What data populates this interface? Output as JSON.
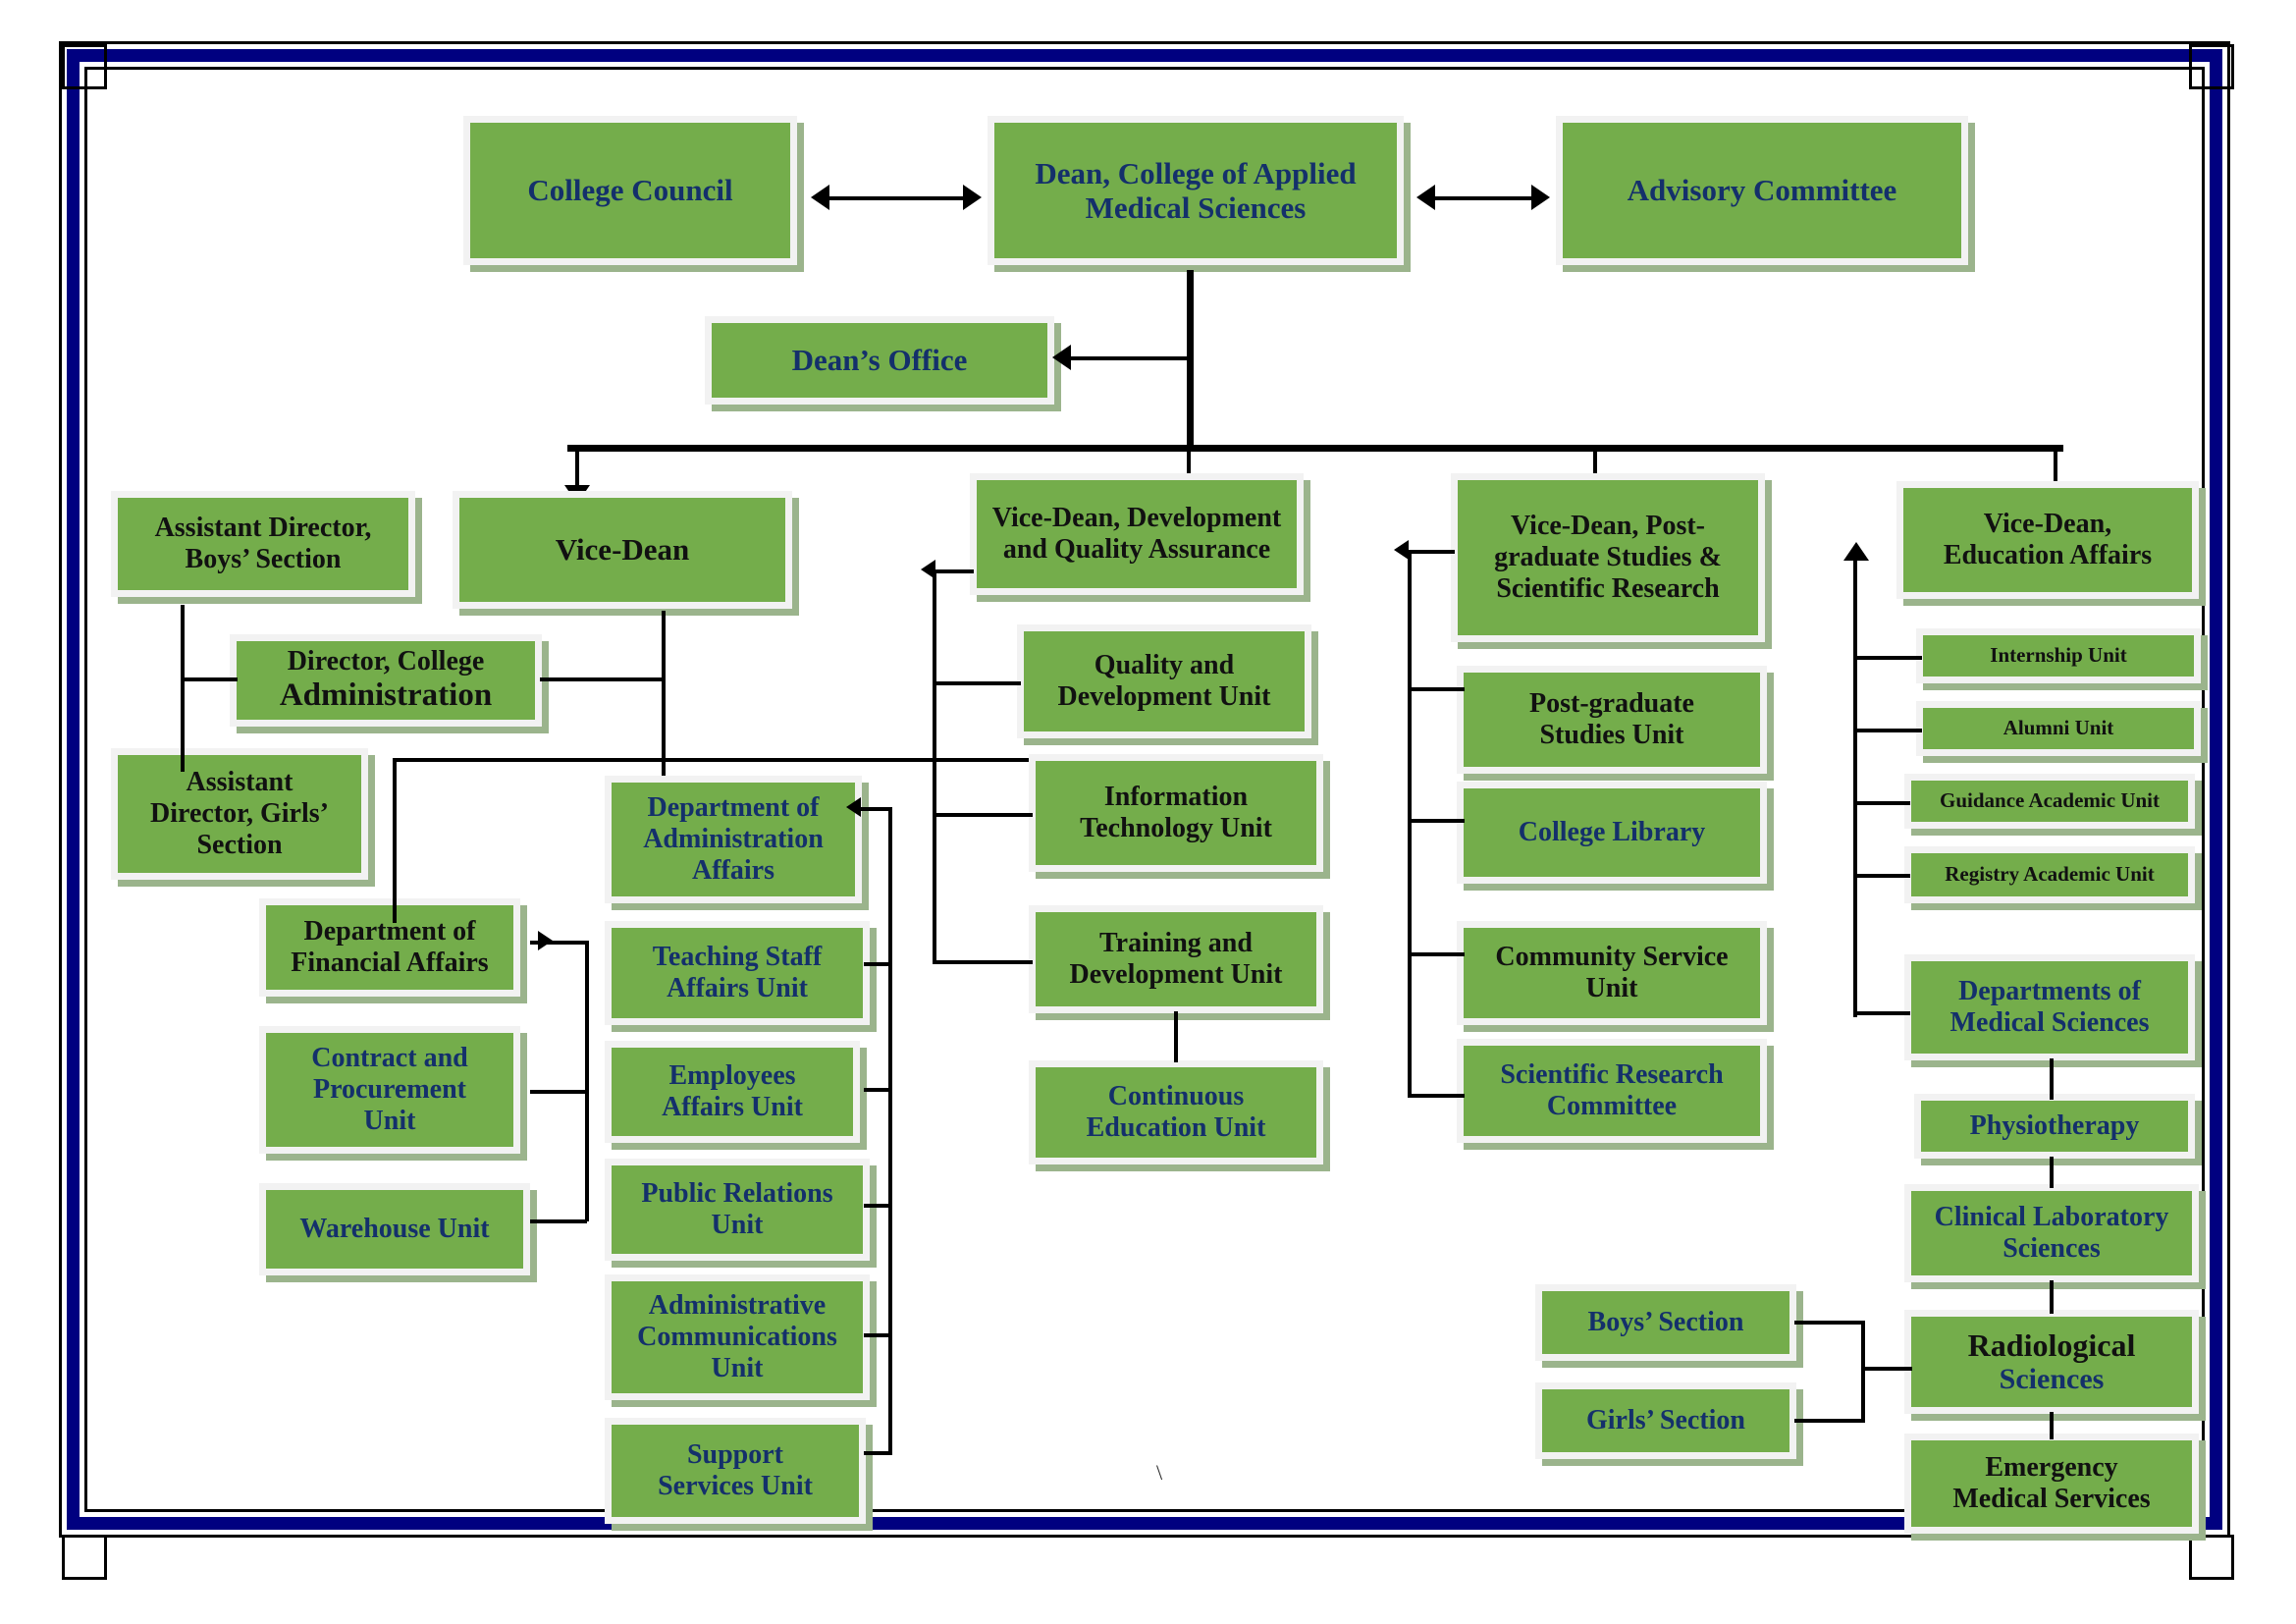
{
  "document": {
    "title": "College of Applied Medical Sciences — Organizational Chart",
    "frame_color": "#000080",
    "node_fill": "#74ad4b",
    "node_border": "#f2f2f2",
    "node_shadow": "#9bb48c",
    "text_blue": "#14306b",
    "text_black": "#111111"
  },
  "chart_data": {
    "type": "diagram",
    "subtype": "organizational-chart",
    "title": "College of Applied Medical Sciences Organizational Structure",
    "nodes": {
      "college_council": {
        "label": "College Council",
        "color": "blue"
      },
      "dean": {
        "label": "Dean, College of Applied\nMedical Sciences",
        "color": "blue"
      },
      "advisory_committee": {
        "label": "Advisory Committee",
        "color": "blue"
      },
      "deans_office": {
        "label": "Dean’s Office",
        "color": "blue"
      },
      "assistant_director_boys": {
        "label": "Assistant Director,\nBoys’ Section",
        "color": "black"
      },
      "vice_dean": {
        "label": "Vice-Dean",
        "color": "black"
      },
      "director_college_admin_line1": "Director, College",
      "director_college_admin_line2": "Administration",
      "assistant_director_girls": {
        "label": "Assistant\nDirector, Girls’\nSection",
        "color": "black"
      },
      "dept_financial_affairs": {
        "label": "Department of\nFinancial Affairs",
        "color": "black"
      },
      "contract_procurement": {
        "label": "Contract and\nProcurement\nUnit",
        "color": "blue"
      },
      "warehouse_unit": {
        "label": "Warehouse Unit",
        "color": "blue"
      },
      "dept_administration_affairs": {
        "label": "Department of\nAdministration\nAffairs",
        "color": "blue"
      },
      "teaching_staff_affairs": {
        "label": "Teaching Staff\nAffairs Unit",
        "color": "blue"
      },
      "employees_affairs": {
        "label": "Employees\nAffairs Unit",
        "color": "blue"
      },
      "public_relations": {
        "label": "Public Relations\nUnit",
        "color": "blue"
      },
      "administrative_communications": {
        "label": "Administrative\nCommunications\nUnit",
        "color": "blue"
      },
      "support_services": {
        "label": "Support\nServices Unit",
        "color": "blue"
      },
      "vice_dean_dev_qa": {
        "label": "Vice-Dean, Development\nand Quality Assurance",
        "color": "black"
      },
      "quality_development": {
        "label": "Quality and\nDevelopment Unit",
        "color": "black"
      },
      "information_technology": {
        "label": "Information\nTechnology Unit",
        "color": "black"
      },
      "training_development": {
        "label": "Training and\nDevelopment Unit",
        "color": "black"
      },
      "continuous_education": {
        "label": "Continuous\nEducation Unit",
        "color": "blue"
      },
      "vice_dean_postgrad": {
        "label": "Vice-Dean, Post-\ngraduate Studies &\nScientific Research",
        "color": "black"
      },
      "postgraduate_studies": {
        "label": "Post-graduate\nStudies Unit",
        "color": "black"
      },
      "college_library": {
        "label": "College Library",
        "color": "blue"
      },
      "community_service": {
        "label": "Community Service\nUnit",
        "color": "black"
      },
      "scientific_research_committee": {
        "label": "Scientific Research\nCommittee",
        "color": "blue"
      },
      "vice_dean_education": {
        "label": "Vice-Dean,\nEducation Affairs",
        "color": "black"
      },
      "internship_unit": {
        "label": "Internship Unit",
        "color": "black"
      },
      "alumni_unit": {
        "label": "Alumni Unit",
        "color": "black"
      },
      "guidance_academic": {
        "label": "Guidance Academic Unit",
        "color": "black"
      },
      "registry_academic": {
        "label": "Registry Academic Unit",
        "color": "black"
      },
      "departments_medical_sciences": {
        "label": "Departments of\nMedical Sciences",
        "color": "blue"
      },
      "physiotherapy": {
        "label": "Physiotherapy",
        "color": "blue"
      },
      "clinical_laboratory_sciences": {
        "label": "Clinical Laboratory\nSciences",
        "color": "blue"
      },
      "radiological_line1": "Radiological",
      "radiological_line2": "Sciences",
      "emergency_medical_services": {
        "label": "Emergency\nMedical Services",
        "color": "black"
      },
      "boys_section": {
        "label": "Boys’ Section",
        "color": "blue"
      },
      "girls_section": {
        "label": "Girls’ Section",
        "color": "blue"
      }
    },
    "stray_glyph": "\\",
    "edges": [
      {
        "from": "college_council",
        "to": "dean",
        "style": "double-arrow"
      },
      {
        "from": "dean",
        "to": "advisory_committee",
        "style": "double-arrow"
      },
      {
        "from": "dean",
        "to": "deans_office",
        "style": "arrow-left"
      },
      {
        "from": "dean",
        "to": "vice_dean",
        "style": "arrow-down"
      },
      {
        "from": "dean",
        "to": "vice_dean_dev_qa",
        "style": "arrow-down"
      },
      {
        "from": "dean",
        "to": "vice_dean_postgrad",
        "style": "arrow-down"
      },
      {
        "from": "dean",
        "to": "vice_dean_education",
        "style": "arrow-down"
      },
      {
        "from": "vice_dean",
        "to": "director_college_admin",
        "style": "line"
      },
      {
        "from": "assistant_director_boys",
        "to": "director_college_admin",
        "style": "line"
      },
      {
        "from": "assistant_director_boys",
        "to": "assistant_director_girls",
        "style": "line"
      },
      {
        "from": "vice_dean",
        "to": "dept_administration_affairs",
        "style": "line"
      },
      {
        "from": "vice_dean",
        "to": "dept_financial_affairs",
        "style": "line"
      },
      {
        "from": "dept_financial_affairs",
        "to": "contract_procurement",
        "style": "line"
      },
      {
        "from": "dept_financial_affairs",
        "to": "warehouse_unit",
        "style": "line"
      },
      {
        "from": "dept_administration_affairs",
        "to": "teaching_staff_affairs",
        "style": "line"
      },
      {
        "from": "dept_administration_affairs",
        "to": "employees_affairs",
        "style": "line"
      },
      {
        "from": "dept_administration_affairs",
        "to": "public_relations",
        "style": "line"
      },
      {
        "from": "dept_administration_affairs",
        "to": "administrative_communications",
        "style": "line"
      },
      {
        "from": "dept_administration_affairs",
        "to": "support_services",
        "style": "line"
      },
      {
        "from": "vice_dean_dev_qa",
        "to": "quality_development",
        "style": "line"
      },
      {
        "from": "vice_dean_dev_qa",
        "to": "information_technology",
        "style": "line"
      },
      {
        "from": "vice_dean_dev_qa",
        "to": "training_development",
        "style": "line"
      },
      {
        "from": "training_development",
        "to": "continuous_education",
        "style": "line"
      },
      {
        "from": "vice_dean_postgrad",
        "to": "postgraduate_studies",
        "style": "line"
      },
      {
        "from": "vice_dean_postgrad",
        "to": "college_library",
        "style": "line"
      },
      {
        "from": "vice_dean_postgrad",
        "to": "community_service",
        "style": "line"
      },
      {
        "from": "vice_dean_postgrad",
        "to": "scientific_research_committee",
        "style": "line"
      },
      {
        "from": "vice_dean_education",
        "to": "internship_unit",
        "style": "line"
      },
      {
        "from": "vice_dean_education",
        "to": "alumni_unit",
        "style": "line"
      },
      {
        "from": "vice_dean_education",
        "to": "guidance_academic",
        "style": "line"
      },
      {
        "from": "vice_dean_education",
        "to": "registry_academic",
        "style": "line"
      },
      {
        "from": "vice_dean_education",
        "to": "departments_medical_sciences",
        "style": "line"
      },
      {
        "from": "departments_medical_sciences",
        "to": "physiotherapy",
        "style": "line"
      },
      {
        "from": "physiotherapy",
        "to": "clinical_laboratory_sciences",
        "style": "line"
      },
      {
        "from": "clinical_laboratory_sciences",
        "to": "radiological_sciences",
        "style": "line"
      },
      {
        "from": "radiological_sciences",
        "to": "emergency_medical_services",
        "style": "line"
      },
      {
        "from": "boys_section",
        "to": "radiological_sciences",
        "style": "line"
      },
      {
        "from": "girls_section",
        "to": "radiological_sciences",
        "style": "line"
      }
    ]
  }
}
